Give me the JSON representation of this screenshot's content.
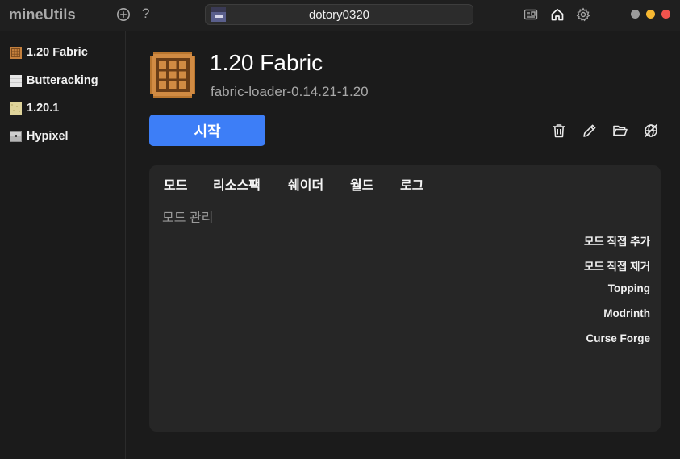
{
  "app": {
    "name": "mineUtils"
  },
  "titlebar": {
    "add_icon": "plus-circle-icon",
    "help_label": "?",
    "account_name": "dotory0320",
    "icons": [
      "news-icon",
      "home-icon",
      "gear-icon"
    ],
    "window_dots": [
      {
        "name": "dot-gray",
        "color": "#9b9b9b"
      },
      {
        "name": "dot-yellow",
        "color": "#f5b731"
      },
      {
        "name": "dot-red",
        "color": "#f0534d"
      }
    ]
  },
  "sidebar": {
    "items": [
      {
        "label": "1.20 Fabric",
        "icon": "crafting-table-icon"
      },
      {
        "label": "Butteracking",
        "icon": "white-block-icon"
      },
      {
        "label": "1.20.1",
        "icon": "sand-block-icon"
      },
      {
        "label": "Hypixel",
        "icon": "chest-icon"
      }
    ]
  },
  "profile": {
    "title": "1.20 Fabric",
    "subtitle": "fabric-loader-0.14.21-1.20",
    "start_label": "시작",
    "actions": [
      "trash-icon",
      "pencil-icon",
      "folder-open-icon",
      "globe-off-icon"
    ]
  },
  "panel": {
    "tabs": [
      "모드",
      "리소스팩",
      "쉐이더",
      "월드",
      "로그"
    ],
    "section_title": "모드 관리",
    "side_actions": [
      "모드 직접 추가",
      "모드 직접 제거",
      "Topping",
      "Modrinth",
      "Curse Forge"
    ]
  },
  "colors": {
    "accent": "#3d7ef7",
    "background": "#1b1b1b",
    "panel": "#262626",
    "crafting_table": "#c4803d"
  }
}
